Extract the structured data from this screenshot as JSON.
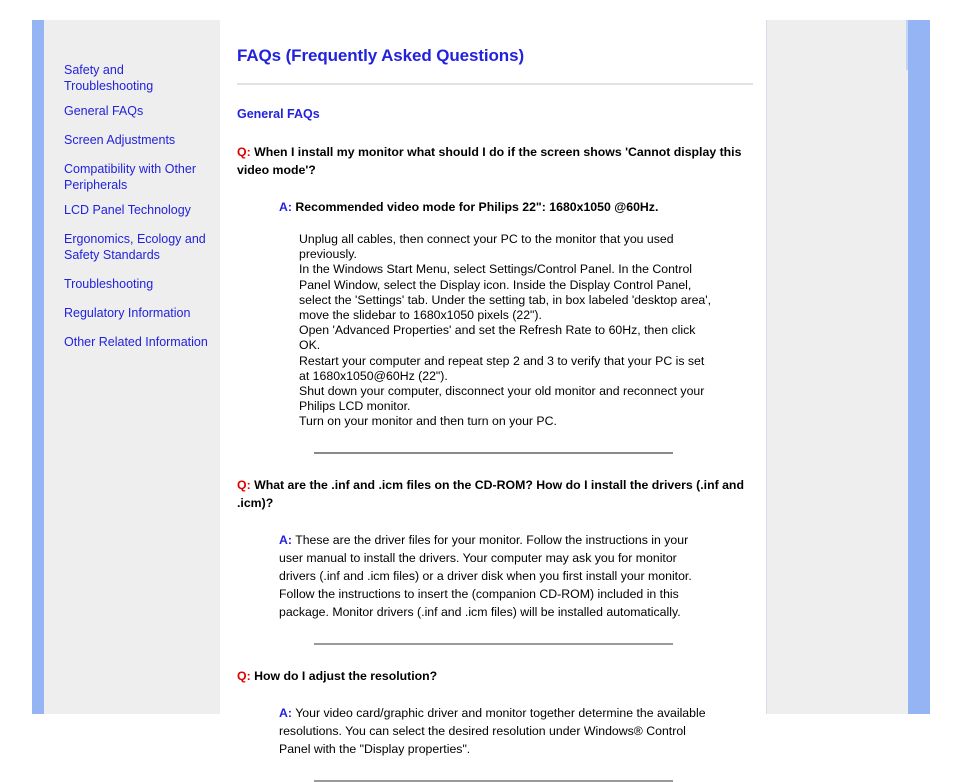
{
  "sidebar": {
    "items": [
      {
        "label": "Safety and Troubleshooting",
        "group": 0
      },
      {
        "label": "General FAQs",
        "group": 1
      },
      {
        "label": "Screen Adjustments",
        "group": 1
      },
      {
        "label": "Compatibility with Other Peripherals",
        "group": 1
      },
      {
        "label": "LCD Panel Technology",
        "group": 1
      },
      {
        "label": "Ergonomics, Ecology and Safety Standards",
        "group": 2
      },
      {
        "label": "Troubleshooting",
        "group": 3
      },
      {
        "label": "Regulatory Information",
        "group": 4
      },
      {
        "label": "Other Related Information",
        "group": 5
      }
    ]
  },
  "main": {
    "title": "FAQs (Frequently Asked Questions)",
    "section_heading": "General FAQs",
    "q_marker": "Q:",
    "a_marker": "A:",
    "qa": [
      {
        "question": "When I install my monitor what should I do if the screen shows 'Cannot display this video mode'?",
        "answer": "Recommended video mode for Philips 22\": 1680x1050 @60Hz.",
        "answer_bold": true,
        "steps": [
          "Unplug all cables, then connect your PC to the monitor that you used previously.",
          "In the Windows Start Menu, select Settings/Control Panel. In the Control Panel Window, select the Display icon. Inside the Display Control Panel, select the 'Settings' tab. Under the setting tab, in box labeled 'desktop area', move the slidebar to 1680x1050 pixels (22\").",
          "Open 'Advanced Properties' and set the Refresh Rate to 60Hz, then click OK.",
          "Restart your computer and repeat step 2 and 3 to verify that your PC is set at 1680x1050@60Hz (22\").",
          "Shut down your computer, disconnect your old monitor and reconnect your Philips LCD monitor.",
          "Turn on your monitor and then turn on your PC."
        ]
      },
      {
        "question": "What are the .inf and .icm files on the CD-ROM? How do I install the drivers (.inf and .icm)?",
        "answer": "These are the driver files for your monitor. Follow the instructions in your user manual to install the drivers. Your computer may ask you for monitor drivers (.inf and .icm files) or a driver disk when you first install your monitor. Follow the instructions to insert the (companion CD-ROM) included in this package. Monitor drivers (.inf and .icm files) will be installed automatically.",
        "answer_bold": false,
        "steps": []
      },
      {
        "question": "How do I adjust the resolution?",
        "answer": "Your video card/graphic driver and monitor together determine the available resolutions. You can select the desired resolution under Windows® Control Panel with the \"Display properties\".",
        "answer_bold": false,
        "steps": []
      }
    ]
  },
  "colors": {
    "link_blue": "#2222dd",
    "accent_blue": "#94b4f4",
    "q_red": "#e00000",
    "panel_gray": "#eeeeee",
    "rule_gray": "#8a8a8a"
  }
}
